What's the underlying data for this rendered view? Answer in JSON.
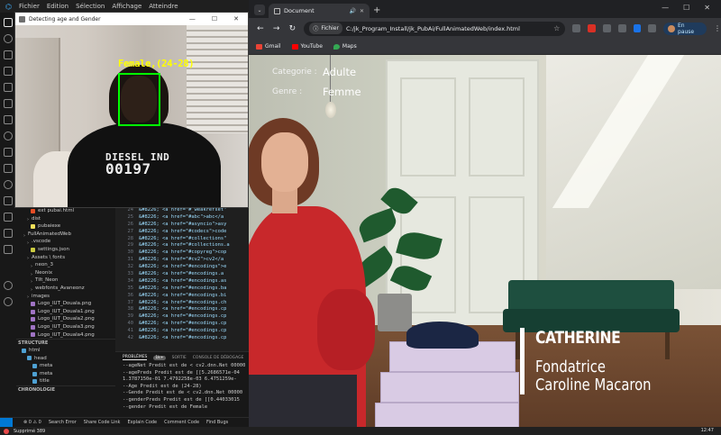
{
  "vscode": {
    "menu": [
      "Fichier",
      "Edition",
      "Sélection",
      "Affichage",
      "Atteindre"
    ],
    "explorer": {
      "rows": [
        {
          "label": "ext pubai.html",
          "icon": "html",
          "indent": 4
        },
        {
          "label": "dist",
          "icon": "folder",
          "indent": 3
        },
        {
          "label": "pubaiexe",
          "icon": "js",
          "indent": 4
        },
        {
          "label": "FullAnimatedWeb",
          "icon": "folder",
          "indent": 2
        },
        {
          "label": ".vscode",
          "icon": "folder",
          "indent": 3
        },
        {
          "label": "settings.json",
          "icon": "json",
          "indent": 4
        },
        {
          "label": "Assets \\ fonts",
          "icon": "folder",
          "indent": 3
        },
        {
          "label": "neon_3",
          "icon": "folder",
          "indent": 4
        },
        {
          "label": "Neonix",
          "icon": "folder",
          "indent": 4
        },
        {
          "label": "Tilt_Neon",
          "icon": "folder",
          "indent": 4
        },
        {
          "label": "webfonts_Avaneonz",
          "icon": "folder",
          "indent": 4
        },
        {
          "label": "images",
          "icon": "folder",
          "indent": 3
        },
        {
          "label": "Logo_IUT_Douala.png",
          "icon": "png",
          "indent": 4
        },
        {
          "label": "Logo_IUT_Douala1.png",
          "icon": "png",
          "indent": 4
        },
        {
          "label": "Logo_IUT_Douala2.png",
          "icon": "png",
          "indent": 4
        },
        {
          "label": "Logo_IUT_Douala3.png",
          "icon": "png",
          "indent": 4
        },
        {
          "label": "Logo_IUT_Douala4.png",
          "icon": "png",
          "indent": 4
        }
      ],
      "structure_header": "STRUCTURE",
      "structure_rows": [
        {
          "label": "html",
          "indent": 1
        },
        {
          "label": "head",
          "indent": 2
        },
        {
          "label": "meta",
          "indent": 3
        },
        {
          "label": "meta",
          "indent": 3
        },
        {
          "label": "title",
          "indent": 3
        }
      ],
      "timeline_header": "CHRONOLOGIE"
    },
    "editor": {
      "lines": [
        {
          "n": "24",
          "text": "&#8226;   <a href=\"#_weakrefset\""
        },
        {
          "n": "25",
          "text": "&#8226;   <a href=\"#abc\">abc</a"
        },
        {
          "n": "26",
          "text": "&#8226;   <a href=\"#asyncio\">asy"
        },
        {
          "n": "27",
          "text": "&#8226;   <a href=\"#codecs\">code"
        },
        {
          "n": "28",
          "text": "&#8226;   <a href=\"#collections\""
        },
        {
          "n": "29",
          "text": "&#8226;   <a href=\"#collections.a"
        },
        {
          "n": "30",
          "text": "&#8226;   <a href=\"#copyreg\">cop"
        },
        {
          "n": "31",
          "text": "&#8226;   <a href=\"#cv2\">cv2</a"
        },
        {
          "n": "32",
          "text": "&#8226;   <a href=\"#encodings\">e"
        },
        {
          "n": "33",
          "text": "&#8226;   <a href=\"#encodings.a"
        },
        {
          "n": "34",
          "text": "&#8226;   <a href=\"#encodings.as"
        },
        {
          "n": "35",
          "text": "&#8226;   <a href=\"#encodings.ba"
        },
        {
          "n": "36",
          "text": "&#8226;   <a href=\"#encodings.bi"
        },
        {
          "n": "37",
          "text": "&#8226;   <a href=\"#encodings.ch"
        },
        {
          "n": "38",
          "text": "&#8226;   <a href=\"#encodings.cp"
        },
        {
          "n": "39",
          "text": "&#8226;   <a href=\"#encodings.cp"
        },
        {
          "n": "40",
          "text": "&#8226;   <a href=\"#encodings.cp"
        },
        {
          "n": "41",
          "text": "&#8226;   <a href=\"#encodings.cp"
        },
        {
          "n": "42",
          "text": "&#8226;   <a href=\"#encodings.cp"
        }
      ]
    },
    "panel": {
      "tabs": [
        "PROBLÈMES",
        "SORTIE",
        "CONSOLE DE DÉBOGAGE"
      ],
      "badge": "1k+",
      "lines": [
        "--ageNet Predit est de < cv2.dnn.Net 00000",
        "--agePreds Predit est de [[5.2686571e-04",
        " 1.3787150e-01 7.4792258e-03 6.4751259e-",
        "--Age Predit est de (24-28)",
        "--Gende Predit est de < cv2.dnn.Net 00000",
        "--genderPreds Predit est de [[0.44033015",
        "--gender Predit est de Female"
      ]
    },
    "status": {
      "items": [
        "⊗ 0 ⚠ 0",
        "Search Error",
        "Share Code Link",
        "Explain Code",
        "Comment Code",
        "Find Bugs"
      ]
    }
  },
  "taskbar": {
    "left": "Supprimé 389",
    "right": "12:47"
  },
  "camera_window": {
    "title": "Detecting age and Gender",
    "detection_label": "Female,(24-28)",
    "shirt_line1": "DIESEL IND",
    "shirt_line2": "00197",
    "controls": [
      "—",
      "☐",
      "✕"
    ]
  },
  "browser": {
    "tab_title": "Document",
    "address_chip": "Fichier",
    "url": "C:/jk_Program_Install/jk_PubAi/FullAnimatedWeb/index.html",
    "profile_label": "En pause",
    "bookmarks": [
      {
        "label": "Gmail",
        "color": "#ea4335"
      },
      {
        "label": "YouTube",
        "color": "#ff0000"
      },
      {
        "label": "Maps",
        "color": "#34a853"
      }
    ],
    "window_controls": [
      "—",
      "☐",
      "✕"
    ]
  },
  "page": {
    "info": [
      {
        "key": "Categorie :",
        "value": "Adulte"
      },
      {
        "key": "Genre :",
        "value": "Femme"
      }
    ],
    "caption": {
      "name": "CATHERINE",
      "role_line1": "Fondatrice",
      "role_line2": "Caroline Macaron"
    }
  },
  "colors": {
    "face_box": "#00ff00",
    "detection_label": "#ffff00",
    "sweater": "#c8282b",
    "bench": "#1e4f3f"
  }
}
